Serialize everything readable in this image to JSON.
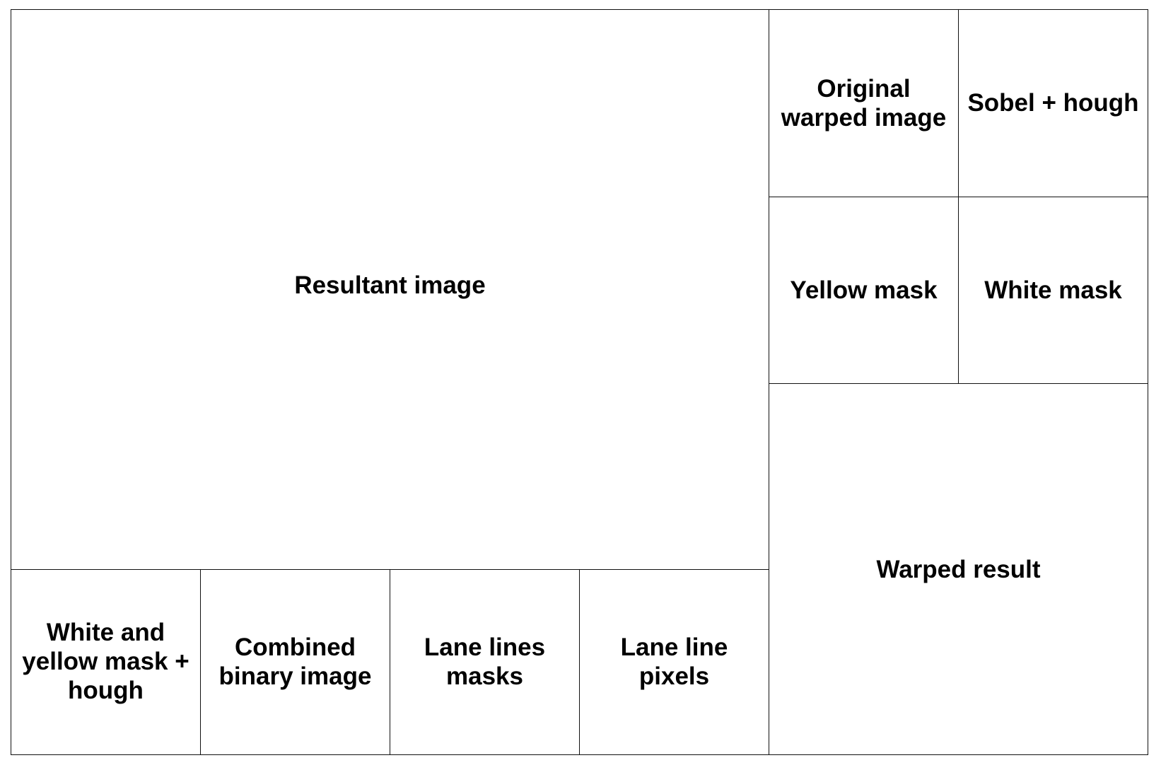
{
  "panels": {
    "resultant": "Resultant image",
    "original_warped": "Original\nwarped image",
    "sobel_hough": "Sobel + hough",
    "yellow_mask": "Yellow mask",
    "white_mask": "White mask",
    "warped_result": "Warped result",
    "white_yellow_hough": "White and\nyellow mask +\nhough",
    "combined_binary": "Combined\nbinary image",
    "lane_lines_masks": "Lane lines\nmasks",
    "lane_line_pixels": "Lane line\npixels"
  },
  "colors": {
    "border": "#111111",
    "text": "#000000",
    "background": "#ffffff"
  }
}
